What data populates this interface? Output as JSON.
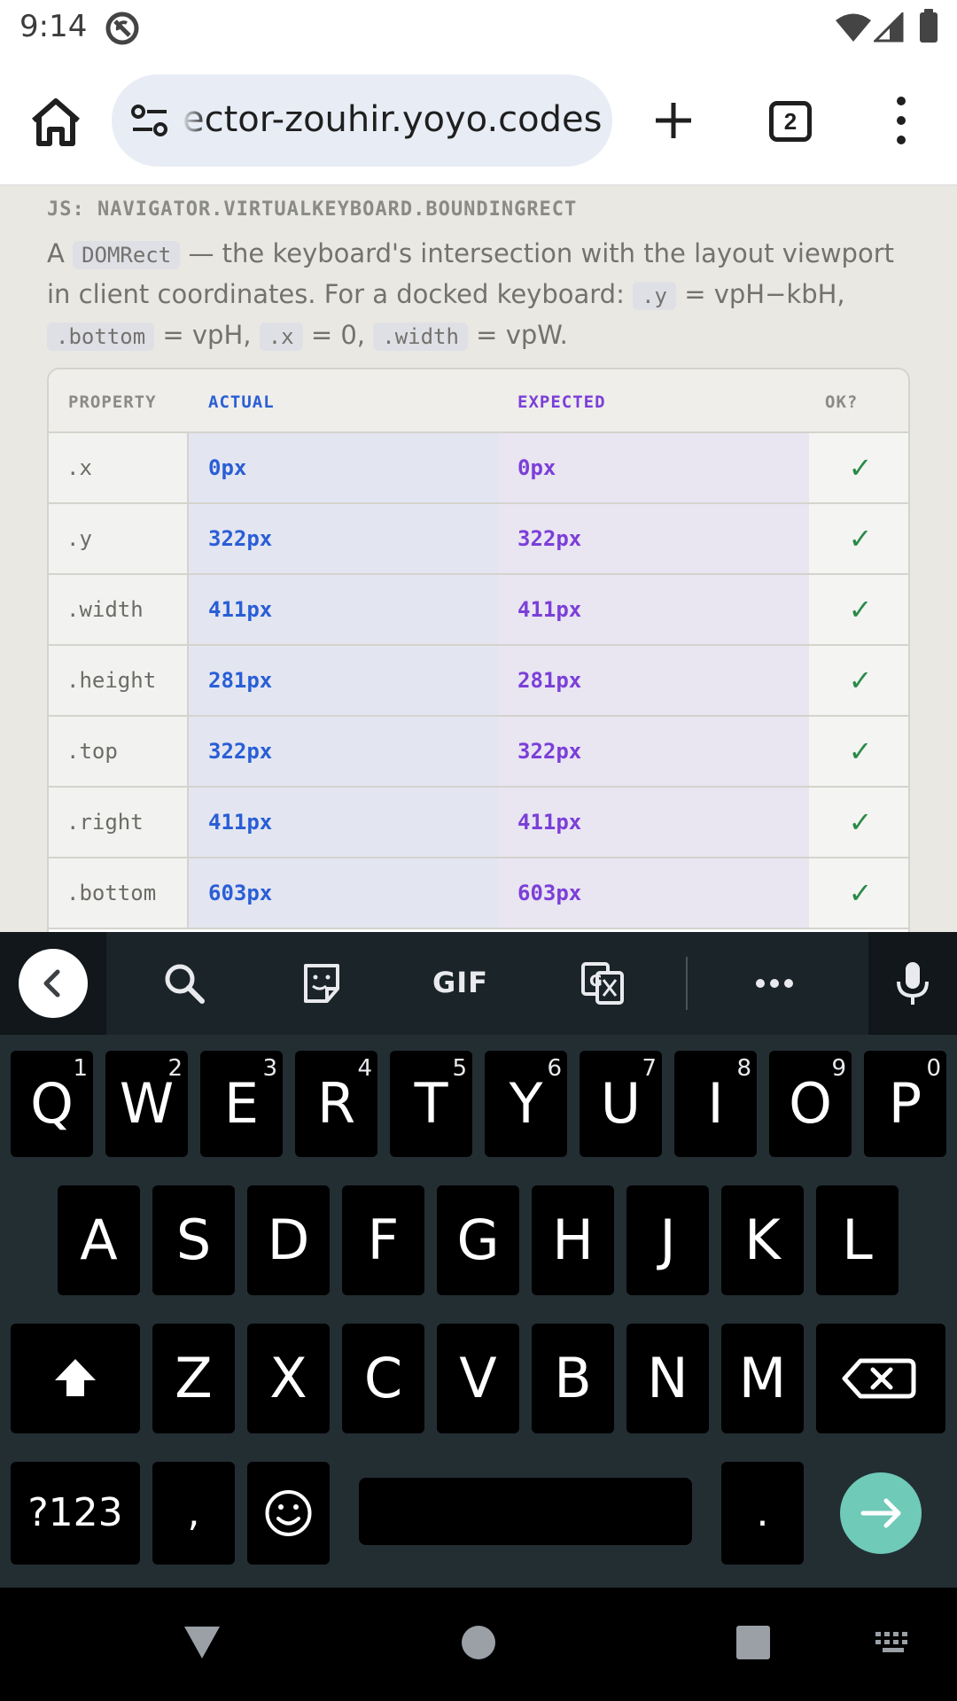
{
  "status_bar": {
    "time": "9:14"
  },
  "browser": {
    "url": "ector-zouhir.yoyo.codes",
    "tab_count": "2"
  },
  "section": {
    "label": "JS: NAVIGATOR.VIRTUALKEYBOARD.BOUNDINGRECT",
    "desc_a": "A",
    "desc_code1": "DOMRect",
    "desc_b": "— the keyboard's intersection with the layout viewport in client coordinates. For a docked keyboard:",
    "desc_code2": ".y",
    "desc_c": "= vpH−kbH,",
    "desc_code3": ".bottom",
    "desc_d": "= vpH,",
    "desc_code4": ".x",
    "desc_e": "= 0,",
    "desc_code5": ".width",
    "desc_f": "= vpW."
  },
  "table": {
    "headers": [
      "PROPERTY",
      "ACTUAL",
      "EXPECTED",
      "OK?"
    ],
    "rows": [
      {
        "property": ".x",
        "actual": "0px",
        "expected": "0px",
        "ok": "✓"
      },
      {
        "property": ".y",
        "actual": "322px",
        "expected": "322px",
        "ok": "✓"
      },
      {
        "property": ".width",
        "actual": "411px",
        "expected": "411px",
        "ok": "✓"
      },
      {
        "property": ".height",
        "actual": "281px",
        "expected": "281px",
        "ok": "✓"
      },
      {
        "property": ".top",
        "actual": "322px",
        "expected": "322px",
        "ok": "✓"
      },
      {
        "property": ".right",
        "actual": "411px",
        "expected": "411px",
        "ok": "✓"
      },
      {
        "property": ".bottom",
        "actual": "603px",
        "expected": "603px",
        "ok": "✓"
      }
    ]
  },
  "keyboard": {
    "gif_label": "GIF",
    "row1": [
      {
        "letter": "Q",
        "hint": "1"
      },
      {
        "letter": "W",
        "hint": "2"
      },
      {
        "letter": "E",
        "hint": "3"
      },
      {
        "letter": "R",
        "hint": "4"
      },
      {
        "letter": "T",
        "hint": "5"
      },
      {
        "letter": "Y",
        "hint": "6"
      },
      {
        "letter": "U",
        "hint": "7"
      },
      {
        "letter": "I",
        "hint": "8"
      },
      {
        "letter": "O",
        "hint": "9"
      },
      {
        "letter": "P",
        "hint": "0"
      }
    ],
    "row2": [
      "A",
      "S",
      "D",
      "F",
      "G",
      "H",
      "J",
      "K",
      "L"
    ],
    "row3": [
      "Z",
      "X",
      "C",
      "V",
      "B",
      "N",
      "M"
    ],
    "symbols_label": "?123",
    "comma_label": ",",
    "period_label": "."
  },
  "colors": {
    "actual": "#2a5ed6",
    "expected": "#7b3fd8",
    "ok": "#2a8a47",
    "enter_key": "#6fcab8"
  }
}
